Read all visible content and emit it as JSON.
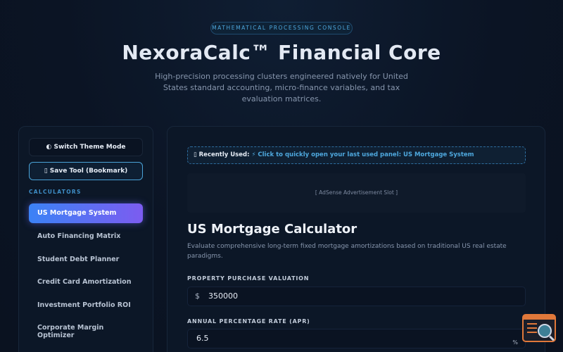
{
  "hero": {
    "badge": "MATHEMATICAL PROCESSING CONSOLE",
    "title": "NexoraCalc™ Financial Core",
    "subtitle": "High-precision processing clusters engineered natively for United States standard accounting, micro-finance variables, and tax evaluation matrices."
  },
  "sidebar": {
    "theme_button": "◐ Switch Theme Mode",
    "save_button": "▯ Save Tool (Bookmark)",
    "section_label": "CALCULATORS",
    "items": [
      {
        "label": "US Mortgage System",
        "active": true
      },
      {
        "label": "Auto Financing Matrix",
        "active": false
      },
      {
        "label": "Student Debt Planner",
        "active": false
      },
      {
        "label": "Credit Card Amortization",
        "active": false
      },
      {
        "label": "Investment Portfolio ROI",
        "active": false
      },
      {
        "label": "Corporate Margin Optimizer",
        "active": false
      }
    ]
  },
  "main": {
    "recent_prefix": "▯ Recently Used:",
    "recent_link": "⚡ Click to quickly open your last used panel: US Mortgage System",
    "ad_slot": "[ AdSense Advertisement Slot ]",
    "calc_title": "US Mortgage Calculator",
    "calc_desc": "Evaluate comprehensive long-term fixed mortgage amortizations based on traditional US real estate paradigms.",
    "fields": [
      {
        "label": "PROPERTY PURCHASE VALUATION",
        "prefix": "$",
        "value": "350000"
      },
      {
        "label": "ANNUAL PERCENTAGE RATE (APR)",
        "value": "6.5",
        "suffix": "%"
      }
    ]
  },
  "colors": {
    "accent": "#4ea8de",
    "active_gradient_start": "#3b82f6",
    "active_gradient_end": "#7c5cf0",
    "widget_orange": "#e0783a"
  },
  "icons": {
    "theme": "half-circle-icon",
    "save": "bookmark-icon",
    "recent": "clock-icon",
    "corner": "search-code-icon"
  }
}
